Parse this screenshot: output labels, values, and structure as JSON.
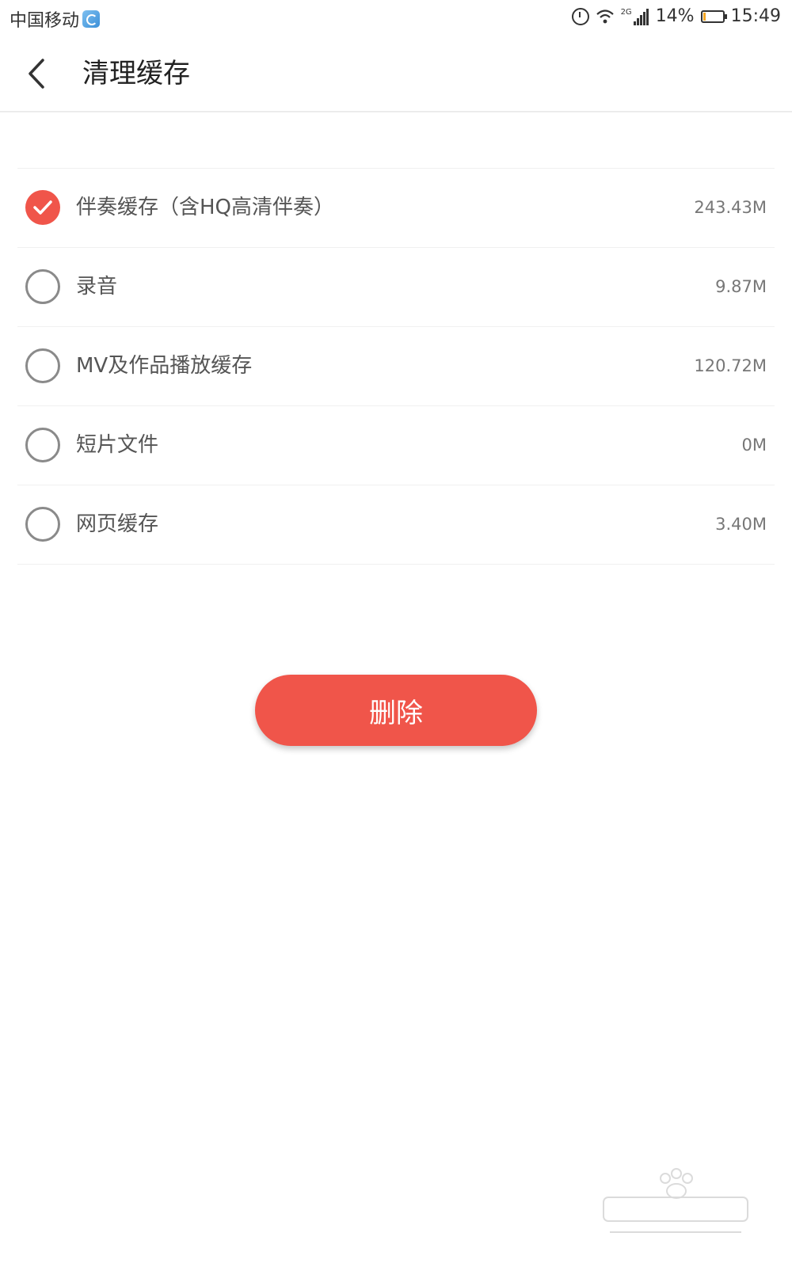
{
  "status_bar": {
    "carrier": "中国移动",
    "network": "2G",
    "battery": "14%",
    "battery_level": 0.14,
    "time": "15:49"
  },
  "header": {
    "title": "清理缓存",
    "back_icon": "chevron-left-icon"
  },
  "cache_items": [
    {
      "label": "伴奏缓存（含HQ高清伴奏）",
      "size": "243.43M",
      "checked": true
    },
    {
      "label": "录音",
      "size": "9.87M",
      "checked": false
    },
    {
      "label": "MV及作品播放缓存",
      "size": "120.72M",
      "checked": false
    },
    {
      "label": "短片文件",
      "size": "0M",
      "checked": false
    },
    {
      "label": "网页缓存",
      "size": "3.40M",
      "checked": false
    }
  ],
  "delete_button": {
    "label": "删除"
  },
  "colors": {
    "accent": "#f0554a",
    "divider": "#f0f0f0",
    "radio_border": "#8a8a8a"
  }
}
